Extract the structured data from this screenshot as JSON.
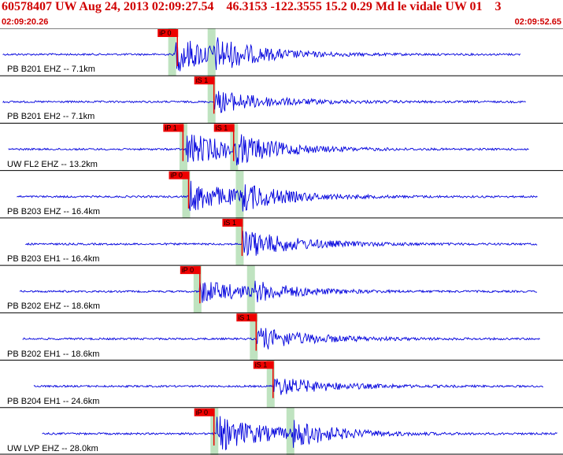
{
  "header": {
    "title": "60578407 UW Aug 24, 2013 02:09:27.54    46.3153 -122.3555 15.2 0.29 Md le vidale UW 01    3",
    "time_start": "02:09:20.26",
    "time_end": "02:09:52.65"
  },
  "colors": {
    "trace": "#0000dd",
    "pick_bg": "#ee0000",
    "pick_fg": "#000000",
    "bar": "#bfe3c0",
    "header_text": "#d00000"
  },
  "traces": [
    {
      "station": "PB B201 EHZ -- 7.1km",
      "picks": [
        {
          "label": "iP 0",
          "t": 0.315
        }
      ],
      "start": 0.005,
      "end": 0.925,
      "onset": 0.31,
      "s_onset": 0.38,
      "amp": 0.9
    },
    {
      "station": "PB B201 EH2 -- 7.1km",
      "picks": [
        {
          "label": "iS 1",
          "t": 0.38
        }
      ],
      "start": 0.005,
      "end": 0.935,
      "onset": 0.38,
      "s_onset": 0.38,
      "amp": 0.6
    },
    {
      "station": "UW FL2 EHZ -- 13.2km",
      "picks": [
        {
          "label": "iP 1",
          "t": 0.325
        },
        {
          "label": "iS 1",
          "t": 0.415
        }
      ],
      "start": 0.015,
      "end": 0.94,
      "onset": 0.33,
      "s_onset": 0.42,
      "amp": 0.85
    },
    {
      "station": "PB B203 EHZ -- 16.4km",
      "picks": [
        {
          "label": "iP 0",
          "t": 0.335
        }
      ],
      "start": 0.03,
      "end": 0.955,
      "onset": 0.335,
      "s_onset": 0.43,
      "amp": 0.8
    },
    {
      "station": "PB B203 EH1 -- 16.4km",
      "picks": [
        {
          "label": "iS 1",
          "t": 0.43
        }
      ],
      "start": 0.045,
      "end": 0.955,
      "onset": 0.43,
      "s_onset": 0.43,
      "amp": 0.75
    },
    {
      "station": "PB B202 EHZ -- 18.6km",
      "picks": [
        {
          "label": "iP 0",
          "t": 0.355
        }
      ],
      "start": 0.035,
      "end": 0.955,
      "onset": 0.355,
      "s_onset": 0.45,
      "amp": 0.6
    },
    {
      "station": "PB B202 EH1 -- 18.6km",
      "picks": [
        {
          "label": "iS 1",
          "t": 0.455
        }
      ],
      "start": 0.04,
      "end": 0.96,
      "onset": 0.455,
      "s_onset": 0.455,
      "amp": 0.6
    },
    {
      "station": "PB B204 EH1 -- 24.6km",
      "picks": [
        {
          "label": "iS 1",
          "t": 0.485
        }
      ],
      "start": 0.06,
      "end": 0.965,
      "onset": 0.485,
      "s_onset": 0.485,
      "amp": 0.5
    },
    {
      "station": "UW LVP EHZ -- 28.0km",
      "picks": [
        {
          "label": "iP 0",
          "t": 0.38
        }
      ],
      "start": 0.075,
      "end": 0.99,
      "onset": 0.385,
      "s_onset": 0.52,
      "amp": 0.9
    }
  ]
}
